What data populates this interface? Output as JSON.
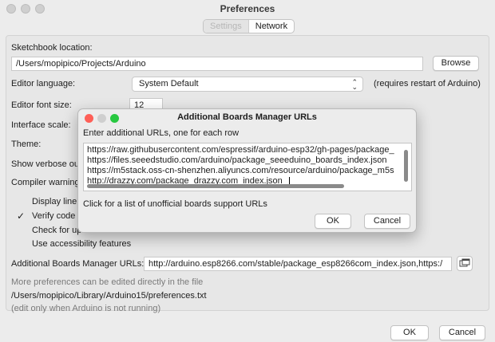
{
  "window": {
    "title": "Preferences"
  },
  "tabs": [
    {
      "label": "Settings"
    },
    {
      "label": "Network"
    }
  ],
  "sketchbook": {
    "label": "Sketchbook location:",
    "value": "/Users/mopipico/Projects/Arduino",
    "browse_label": "Browse"
  },
  "editor_language": {
    "label": "Editor language:",
    "value": "System Default",
    "note": "(requires restart of Arduino)"
  },
  "font_size": {
    "label": "Editor font size:",
    "value": "12"
  },
  "interface_scale": {
    "label": "Interface scale:"
  },
  "theme": {
    "label": "Theme:"
  },
  "verbose": {
    "label": "Show verbose out"
  },
  "compiler_warnings": {
    "label": "Compiler warning"
  },
  "checks": [
    {
      "label": "Display line n",
      "checked": false
    },
    {
      "label": "Verify code a",
      "checked": true
    },
    {
      "label": "Check for upd",
      "checked": false
    },
    {
      "label": "Use accessibility features",
      "checked": false
    }
  ],
  "boards_urls": {
    "label": "Additional Boards Manager URLs:",
    "value": "http://arduino.esp8266.com/stable/package_esp8266com_index.json,https:/"
  },
  "more_prefs": {
    "line1": "More preferences can be edited directly in the file",
    "path": "/Users/mopipico/Library/Arduino15/preferences.txt",
    "line3": "(edit only when Arduino is not running)"
  },
  "footer": {
    "ok_label": "OK",
    "cancel_label": "Cancel"
  },
  "dialog": {
    "title": "Additional Boards Manager URLs",
    "instruction": "Enter additional URLs, one for each row",
    "urls": [
      "https://raw.githubusercontent.com/espressif/arduino-esp32/gh-pages/package_",
      "https://files.seeedstudio.com/arduino/package_seeeduino_boards_index.json",
      "https://m5stack.oss-cn-shenzhen.aliyuncs.com/resource/arduino/package_m5s",
      "http://drazzy.com/package_drazzy.com_index.json"
    ],
    "link_text": "Click for a list of unofficial boards support URLs",
    "ok_label": "OK",
    "cancel_label": "Cancel"
  },
  "colors": {
    "close": "#fe5f57",
    "minimize": "#febc2e",
    "zoom": "#28c840",
    "focus_ring": "#2f7bf5"
  }
}
